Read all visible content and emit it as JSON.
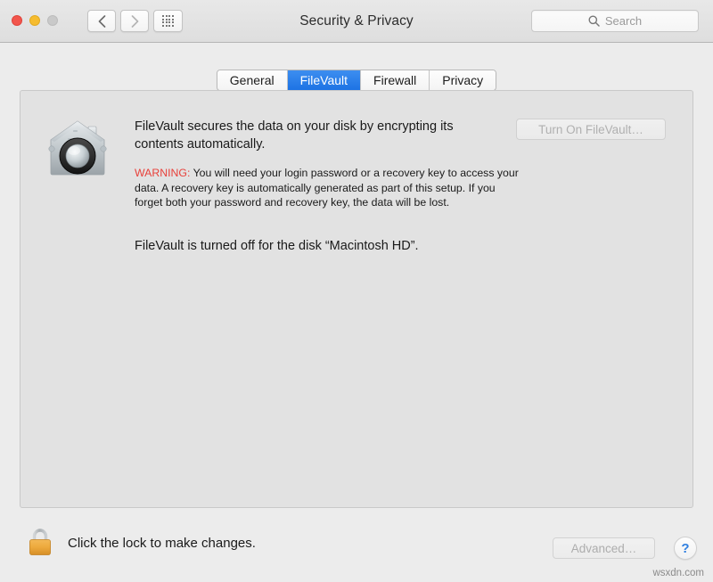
{
  "window": {
    "title": "Security & Privacy",
    "traffic_lights": [
      {
        "name": "close",
        "color": "#f2554c"
      },
      {
        "name": "minimize",
        "color": "#f6bc2f"
      },
      {
        "name": "zoom",
        "color": "#c9c9c9"
      }
    ],
    "nav": {
      "back_icon": "chevron-left-icon",
      "forward_icon": "chevron-right-icon"
    },
    "show_all_icon": "grid-dots-icon"
  },
  "search": {
    "icon": "search-icon",
    "placeholder": "Search",
    "value": ""
  },
  "tabs": [
    {
      "label": "General",
      "active": false
    },
    {
      "label": "FileVault",
      "active": true
    },
    {
      "label": "Firewall",
      "active": false
    },
    {
      "label": "Privacy",
      "active": false
    }
  ],
  "filevault": {
    "icon": "filevault-safe-icon",
    "headline": "FileVault secures the data on your disk by encrypting its contents automatically.",
    "warning_label": "WARNING:",
    "warning_text": " You will need your login password or a recovery key to access your data. A recovery key is automatically generated as part of this setup. If you forget both your password and recovery key, the data will be lost.",
    "status": "FileVault is turned off for the disk “Macintosh HD”.",
    "turn_on_button": "Turn On FileVault…"
  },
  "footer": {
    "lock_icon": "lock-closed-icon",
    "lock_caption": "Click the lock to make changes.",
    "advanced_button": "Advanced…",
    "help_button": "?"
  },
  "watermark": "wsxdn.com",
  "colors": {
    "accent_blue": "#1d73e4",
    "warning_red": "#e8403a",
    "help_blue": "#2f7fe0",
    "lock_gold": "#eda93c",
    "window_bg": "#ececec",
    "panel_bg": "#e2e2e2"
  }
}
